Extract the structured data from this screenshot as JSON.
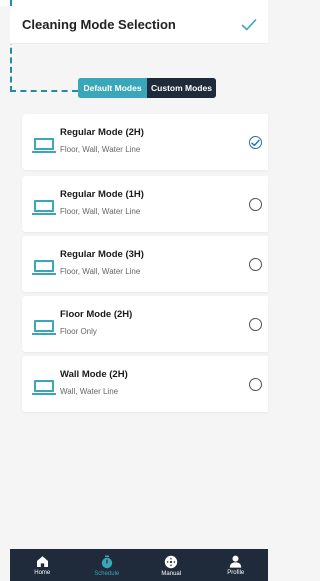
{
  "header": {
    "title": "Cleaning Mode Selection",
    "confirm_icon": "check-icon"
  },
  "tabs": [
    {
      "label": "Default Modes",
      "active": true
    },
    {
      "label": "Custom Modes",
      "active": false
    }
  ],
  "modes": [
    {
      "title": "Regular Mode (2H)",
      "subtitle": "Floor, Wall, Water Line",
      "selected": true
    },
    {
      "title": "Regular Mode (1H)",
      "subtitle": "Floor, Wall, Water Line",
      "selected": false
    },
    {
      "title": "Regular Mode (3H)",
      "subtitle": "Floor, Wall, Water Line",
      "selected": false
    },
    {
      "title": "Floor Mode (2H)",
      "subtitle": "Floor Only",
      "selected": false
    },
    {
      "title": "Wall Mode (2H)",
      "subtitle": "Wall, Water Line",
      "selected": false
    }
  ],
  "nav": [
    {
      "label": "Home",
      "icon": "home-icon",
      "active": false
    },
    {
      "label": "Schedule",
      "icon": "timer-icon",
      "active": true
    },
    {
      "label": "Manual",
      "icon": "gamepad-icon",
      "active": false
    },
    {
      "label": "Profile",
      "icon": "user-icon",
      "active": false
    }
  ],
  "colors": {
    "accent": "#3aa6b9",
    "nav_background": "#1f2a3a",
    "selected_radio": "#1f6fb5"
  }
}
